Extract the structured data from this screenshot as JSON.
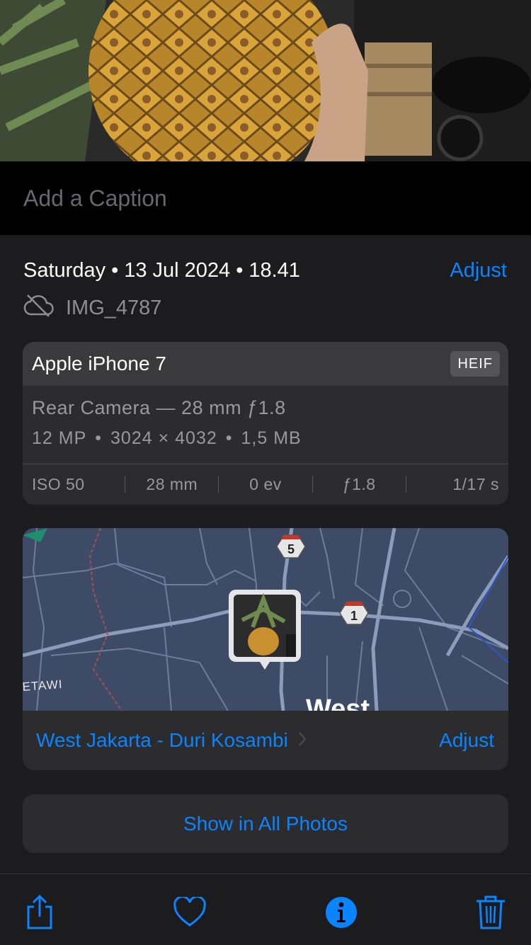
{
  "caption": {
    "placeholder": "Add a Caption"
  },
  "metadata": {
    "day": "Saturday",
    "date": "13 Jul 2024",
    "time": "18.41",
    "adjust_label": "Adjust",
    "filename": "IMG_4787"
  },
  "device": {
    "name": "Apple iPhone 7",
    "format": "HEIF",
    "lens": "Rear Camera — 28 mm ƒ1.8",
    "megapixels": "12 MP",
    "resolution": "3024 × 4032",
    "size": "1,5 MB",
    "exif": {
      "iso": "ISO 50",
      "focal": "28 mm",
      "ev": "0 ev",
      "aperture": "ƒ1.8",
      "shutter": "1/17 s"
    }
  },
  "map": {
    "route_5": "5",
    "route_1": "1",
    "area_label": "ETAWI",
    "city_label": "West",
    "location": "West Jakarta - Duri Kosambi",
    "adjust_label": "Adjust"
  },
  "show_all_label": "Show in All Photos",
  "toolbar": {
    "icons": [
      "share-icon",
      "heart-icon",
      "info-icon",
      "trash-icon"
    ]
  },
  "colors": {
    "accent": "#0a84ff",
    "background": "#1c1c1e",
    "card": "#2c2c2e"
  }
}
